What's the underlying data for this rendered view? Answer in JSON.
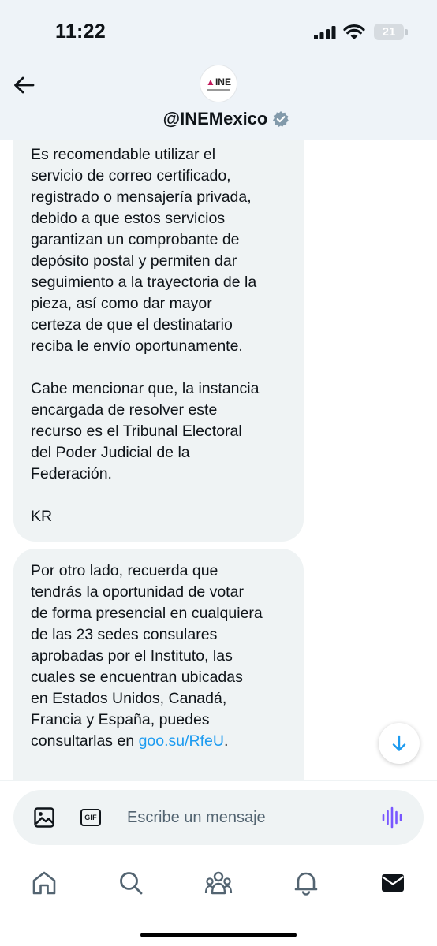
{
  "status_bar": {
    "time": "11:22",
    "battery": "21"
  },
  "header": {
    "avatar_logo": "INE",
    "handle": "@INEMexico",
    "verified": true
  },
  "messages": [
    {
      "text": "Es recomendable utilizar el\nservicio de correo certificado,\nregistrado o mensajería privada,\ndebido a que estos servicios\ngarantizan un comprobante de\ndepósito postal y permiten dar\nseguimiento a la trayectoria de la\npieza, así como dar mayor\ncerteza de que el destinatario\nreciba le envío oportunamente.\n\nCabe mencionar que, la instancia\nencargada de resolver este\nrecurso es el Tribunal Electoral\ndel Poder Judicial de la\nFederación.\n\nKR"
    },
    {
      "text": "Por otro lado, recuerda que\ntendrás la oportunidad de votar\nde forma presencial en cualquiera\nde las 23 sedes consulares\naprobadas por el Instituto, las\ncuales se encuentran ubicadas\nen Estados Unidos, Canadá,\nFrancia y España, puedes\nconsultarlas en ",
      "link": "goo.su/RfeU",
      "text_after": "."
    }
  ],
  "composer": {
    "placeholder": "Escribe un mensaje",
    "gif_label": "GIF"
  },
  "icons": {
    "back": "arrow-left-icon",
    "verified": "verified-badge-icon",
    "scroll_down": "arrow-down-icon",
    "image": "image-icon",
    "gif": "gif-icon",
    "voice": "voice-waveform-icon",
    "tabs": [
      "home-icon",
      "search-icon",
      "communities-icon",
      "notifications-icon",
      "messages-icon"
    ]
  },
  "colors": {
    "accent": "#1d9bf0",
    "bubble": "#eff3f4",
    "header_bg": "#eef3f8",
    "voice": "#7856ff"
  }
}
